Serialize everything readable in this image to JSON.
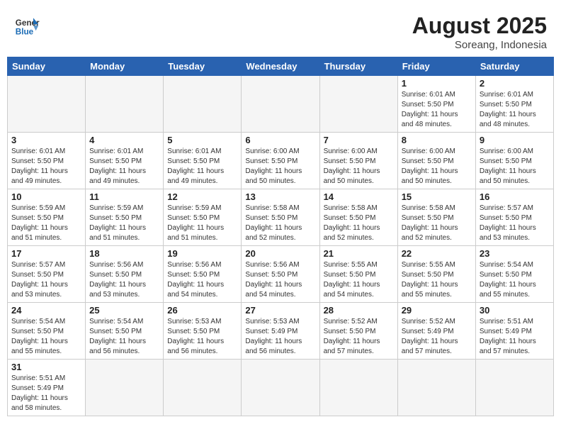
{
  "header": {
    "logo_general": "General",
    "logo_blue": "Blue",
    "month": "August 2025",
    "location": "Soreang, Indonesia"
  },
  "weekdays": [
    "Sunday",
    "Monday",
    "Tuesday",
    "Wednesday",
    "Thursday",
    "Friday",
    "Saturday"
  ],
  "weeks": [
    [
      {
        "day": "",
        "info": ""
      },
      {
        "day": "",
        "info": ""
      },
      {
        "day": "",
        "info": ""
      },
      {
        "day": "",
        "info": ""
      },
      {
        "day": "",
        "info": ""
      },
      {
        "day": "1",
        "info": "Sunrise: 6:01 AM\nSunset: 5:50 PM\nDaylight: 11 hours\nand 48 minutes."
      },
      {
        "day": "2",
        "info": "Sunrise: 6:01 AM\nSunset: 5:50 PM\nDaylight: 11 hours\nand 48 minutes."
      }
    ],
    [
      {
        "day": "3",
        "info": "Sunrise: 6:01 AM\nSunset: 5:50 PM\nDaylight: 11 hours\nand 49 minutes."
      },
      {
        "day": "4",
        "info": "Sunrise: 6:01 AM\nSunset: 5:50 PM\nDaylight: 11 hours\nand 49 minutes."
      },
      {
        "day": "5",
        "info": "Sunrise: 6:01 AM\nSunset: 5:50 PM\nDaylight: 11 hours\nand 49 minutes."
      },
      {
        "day": "6",
        "info": "Sunrise: 6:00 AM\nSunset: 5:50 PM\nDaylight: 11 hours\nand 50 minutes."
      },
      {
        "day": "7",
        "info": "Sunrise: 6:00 AM\nSunset: 5:50 PM\nDaylight: 11 hours\nand 50 minutes."
      },
      {
        "day": "8",
        "info": "Sunrise: 6:00 AM\nSunset: 5:50 PM\nDaylight: 11 hours\nand 50 minutes."
      },
      {
        "day": "9",
        "info": "Sunrise: 6:00 AM\nSunset: 5:50 PM\nDaylight: 11 hours\nand 50 minutes."
      }
    ],
    [
      {
        "day": "10",
        "info": "Sunrise: 5:59 AM\nSunset: 5:50 PM\nDaylight: 11 hours\nand 51 minutes."
      },
      {
        "day": "11",
        "info": "Sunrise: 5:59 AM\nSunset: 5:50 PM\nDaylight: 11 hours\nand 51 minutes."
      },
      {
        "day": "12",
        "info": "Sunrise: 5:59 AM\nSunset: 5:50 PM\nDaylight: 11 hours\nand 51 minutes."
      },
      {
        "day": "13",
        "info": "Sunrise: 5:58 AM\nSunset: 5:50 PM\nDaylight: 11 hours\nand 52 minutes."
      },
      {
        "day": "14",
        "info": "Sunrise: 5:58 AM\nSunset: 5:50 PM\nDaylight: 11 hours\nand 52 minutes."
      },
      {
        "day": "15",
        "info": "Sunrise: 5:58 AM\nSunset: 5:50 PM\nDaylight: 11 hours\nand 52 minutes."
      },
      {
        "day": "16",
        "info": "Sunrise: 5:57 AM\nSunset: 5:50 PM\nDaylight: 11 hours\nand 53 minutes."
      }
    ],
    [
      {
        "day": "17",
        "info": "Sunrise: 5:57 AM\nSunset: 5:50 PM\nDaylight: 11 hours\nand 53 minutes."
      },
      {
        "day": "18",
        "info": "Sunrise: 5:56 AM\nSunset: 5:50 PM\nDaylight: 11 hours\nand 53 minutes."
      },
      {
        "day": "19",
        "info": "Sunrise: 5:56 AM\nSunset: 5:50 PM\nDaylight: 11 hours\nand 54 minutes."
      },
      {
        "day": "20",
        "info": "Sunrise: 5:56 AM\nSunset: 5:50 PM\nDaylight: 11 hours\nand 54 minutes."
      },
      {
        "day": "21",
        "info": "Sunrise: 5:55 AM\nSunset: 5:50 PM\nDaylight: 11 hours\nand 54 minutes."
      },
      {
        "day": "22",
        "info": "Sunrise: 5:55 AM\nSunset: 5:50 PM\nDaylight: 11 hours\nand 55 minutes."
      },
      {
        "day": "23",
        "info": "Sunrise: 5:54 AM\nSunset: 5:50 PM\nDaylight: 11 hours\nand 55 minutes."
      }
    ],
    [
      {
        "day": "24",
        "info": "Sunrise: 5:54 AM\nSunset: 5:50 PM\nDaylight: 11 hours\nand 55 minutes."
      },
      {
        "day": "25",
        "info": "Sunrise: 5:54 AM\nSunset: 5:50 PM\nDaylight: 11 hours\nand 56 minutes."
      },
      {
        "day": "26",
        "info": "Sunrise: 5:53 AM\nSunset: 5:50 PM\nDaylight: 11 hours\nand 56 minutes."
      },
      {
        "day": "27",
        "info": "Sunrise: 5:53 AM\nSunset: 5:49 PM\nDaylight: 11 hours\nand 56 minutes."
      },
      {
        "day": "28",
        "info": "Sunrise: 5:52 AM\nSunset: 5:50 PM\nDaylight: 11 hours\nand 57 minutes."
      },
      {
        "day": "29",
        "info": "Sunrise: 5:52 AM\nSunset: 5:49 PM\nDaylight: 11 hours\nand 57 minutes."
      },
      {
        "day": "30",
        "info": "Sunrise: 5:51 AM\nSunset: 5:49 PM\nDaylight: 11 hours\nand 57 minutes."
      }
    ],
    [
      {
        "day": "31",
        "info": "Sunrise: 5:51 AM\nSunset: 5:49 PM\nDaylight: 11 hours\nand 58 minutes."
      },
      {
        "day": "",
        "info": ""
      },
      {
        "day": "",
        "info": ""
      },
      {
        "day": "",
        "info": ""
      },
      {
        "day": "",
        "info": ""
      },
      {
        "day": "",
        "info": ""
      },
      {
        "day": "",
        "info": ""
      }
    ]
  ]
}
